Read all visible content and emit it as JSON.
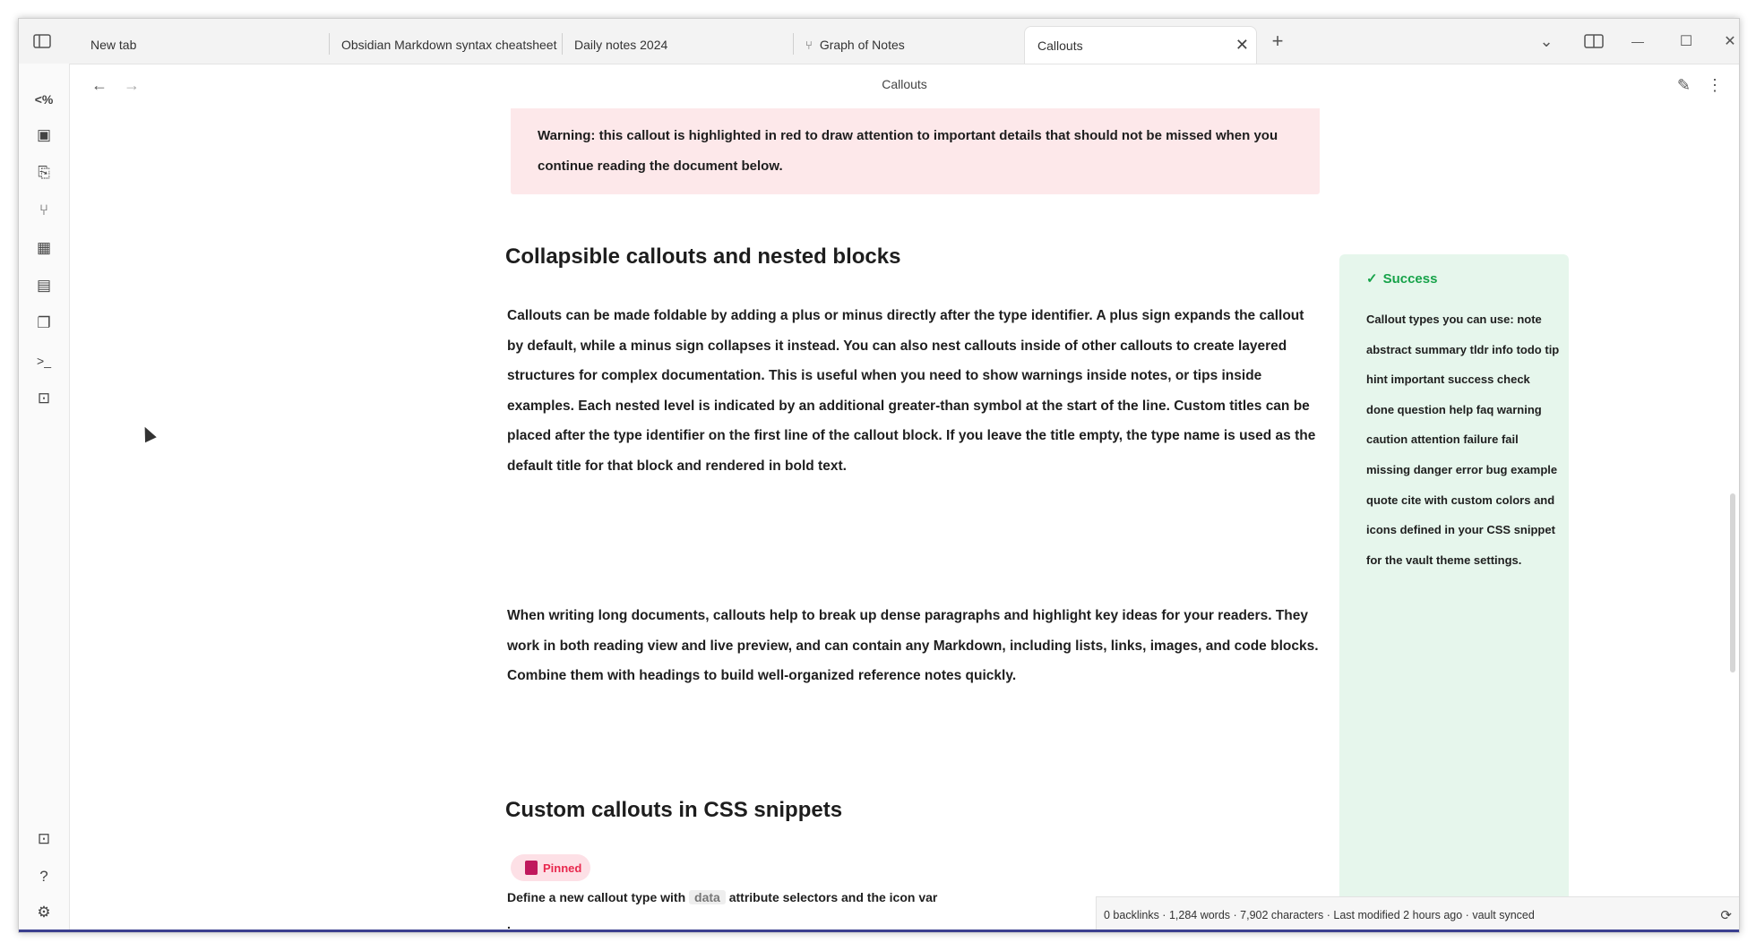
{
  "tabs": [
    {
      "label": "New tab"
    },
    {
      "label": "Obsidian Markdown syntax cheatsheet"
    },
    {
      "label": "Daily notes 2024"
    },
    {
      "label": "Graph of Notes",
      "icon": "graph-icon"
    },
    {
      "label": "Callouts"
    }
  ],
  "window": {
    "new_tab": "+",
    "dropdown": "⌄",
    "split": "▯▯",
    "minimize": "—",
    "maximize": "☐",
    "close": "✕"
  },
  "ribbon": {
    "items": [
      "<%",
      "▣",
      "⎘",
      "⑂",
      "▦",
      "▤",
      "❐",
      ">_",
      "⊡"
    ],
    "bottom": [
      "⊡",
      "?",
      "⚙"
    ]
  },
  "nav": {
    "back": "←",
    "forward": "→",
    "title": "Callouts",
    "edit": "✎",
    "more": "⋮"
  },
  "callout_red": {
    "text": "Warning: this callout is highlighted in red to draw attention to important details that should not be missed when you continue reading the document below."
  },
  "section1": {
    "heading": "Collapsible callouts and nested blocks",
    "para1": "Callouts can be made foldable by adding a plus or minus directly after the type identifier. A plus sign expands the callout by default, while a minus sign collapses it instead. You can also nest callouts inside of other callouts to create layered structures for complex documentation. This is useful when you need to show warnings inside notes, or tips inside examples. Each nested level is indicated by an additional greater-than symbol at the start of the line. Custom titles can be placed after the type identifier on the first line of the callout block. If you leave the title empty, the type name is used as the default title for that block and rendered in bold text.",
    "para2": "When writing long documents, callouts help to break up dense paragraphs and highlight key ideas for your readers. They work in both reading view and live preview, and can contain any Markdown, including lists, links, images, and code blocks. Combine them with headings to build well-organized reference notes quickly."
  },
  "aside": {
    "title": "Success",
    "body": "Callout types you can use: note abstract summary tldr info todo tip hint important success check done question help faq warning caution attention failure fail missing danger error bug example quote cite with custom colors and icons defined in your CSS snippet for the vault theme settings."
  },
  "section2": {
    "heading": "Custom callouts in CSS snippets",
    "pill": "Pinned",
    "line": "Define a new callout type with",
    "code": "data",
    "line_after": "attribute selectors and the icon var",
    "line2": "."
  },
  "statusbar": {
    "text": "0 backlinks · 1,284 words · 7,902 characters · Last modified 2 hours ago · vault synced",
    "icon": "sync-icon"
  }
}
